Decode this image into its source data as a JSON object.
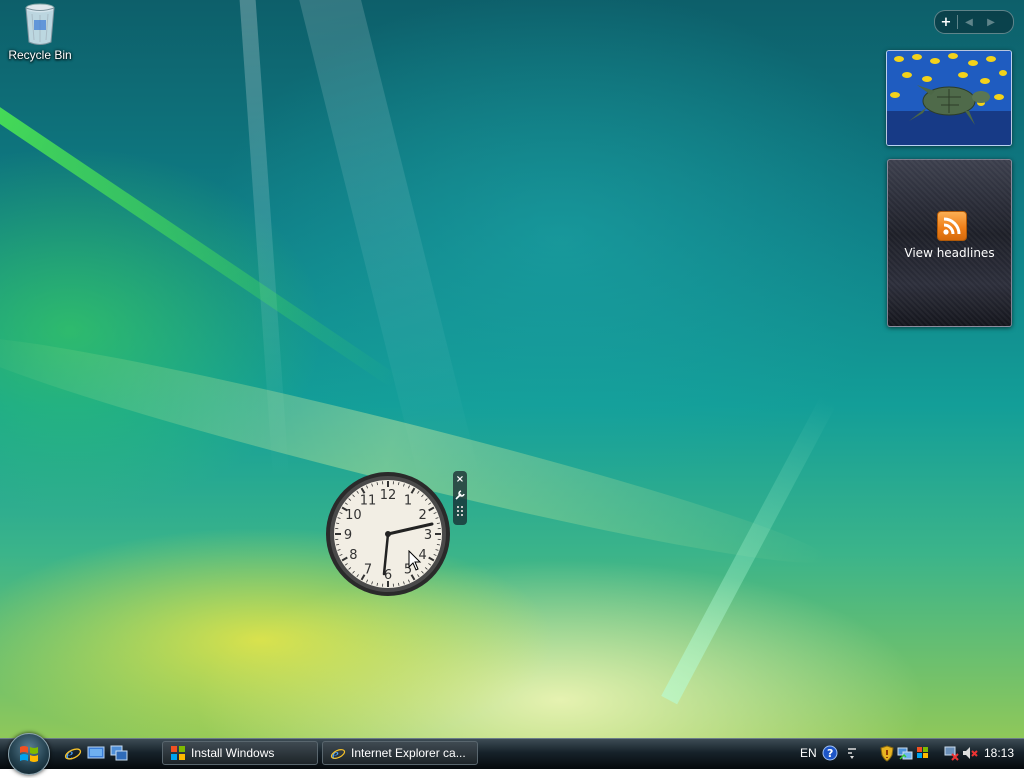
{
  "desktop": {
    "recycle_bin_label": "Recycle Bin"
  },
  "sidebar": {
    "add_symbol": "+",
    "prev_symbol": "◀",
    "next_symbol": "▶"
  },
  "feed_gadget": {
    "label": "View headlines",
    "icon": "rss-icon"
  },
  "clock_gadget": {
    "numbers": [
      "12",
      "1",
      "2",
      "3",
      "4",
      "5",
      "6",
      "7",
      "8",
      "9",
      "10",
      "11"
    ],
    "tools": {
      "close": "×",
      "settings_icon": "wrench-icon",
      "drag_icon": "grip-icon"
    }
  },
  "taskbar": {
    "tasks": [
      {
        "label": "Install Windows",
        "icon": "windows-flag-icon"
      },
      {
        "label": "Internet Explorer ca...",
        "icon": "ie-icon"
      }
    ],
    "quick_launch": [
      "ie-icon",
      "show-desktop-icon",
      "switch-windows-icon"
    ],
    "language": "EN",
    "time": "18:13"
  },
  "colors": {
    "taskbar": "#16222a",
    "rss_orange": "#f0801a",
    "clock_face": "#f2eee4"
  }
}
